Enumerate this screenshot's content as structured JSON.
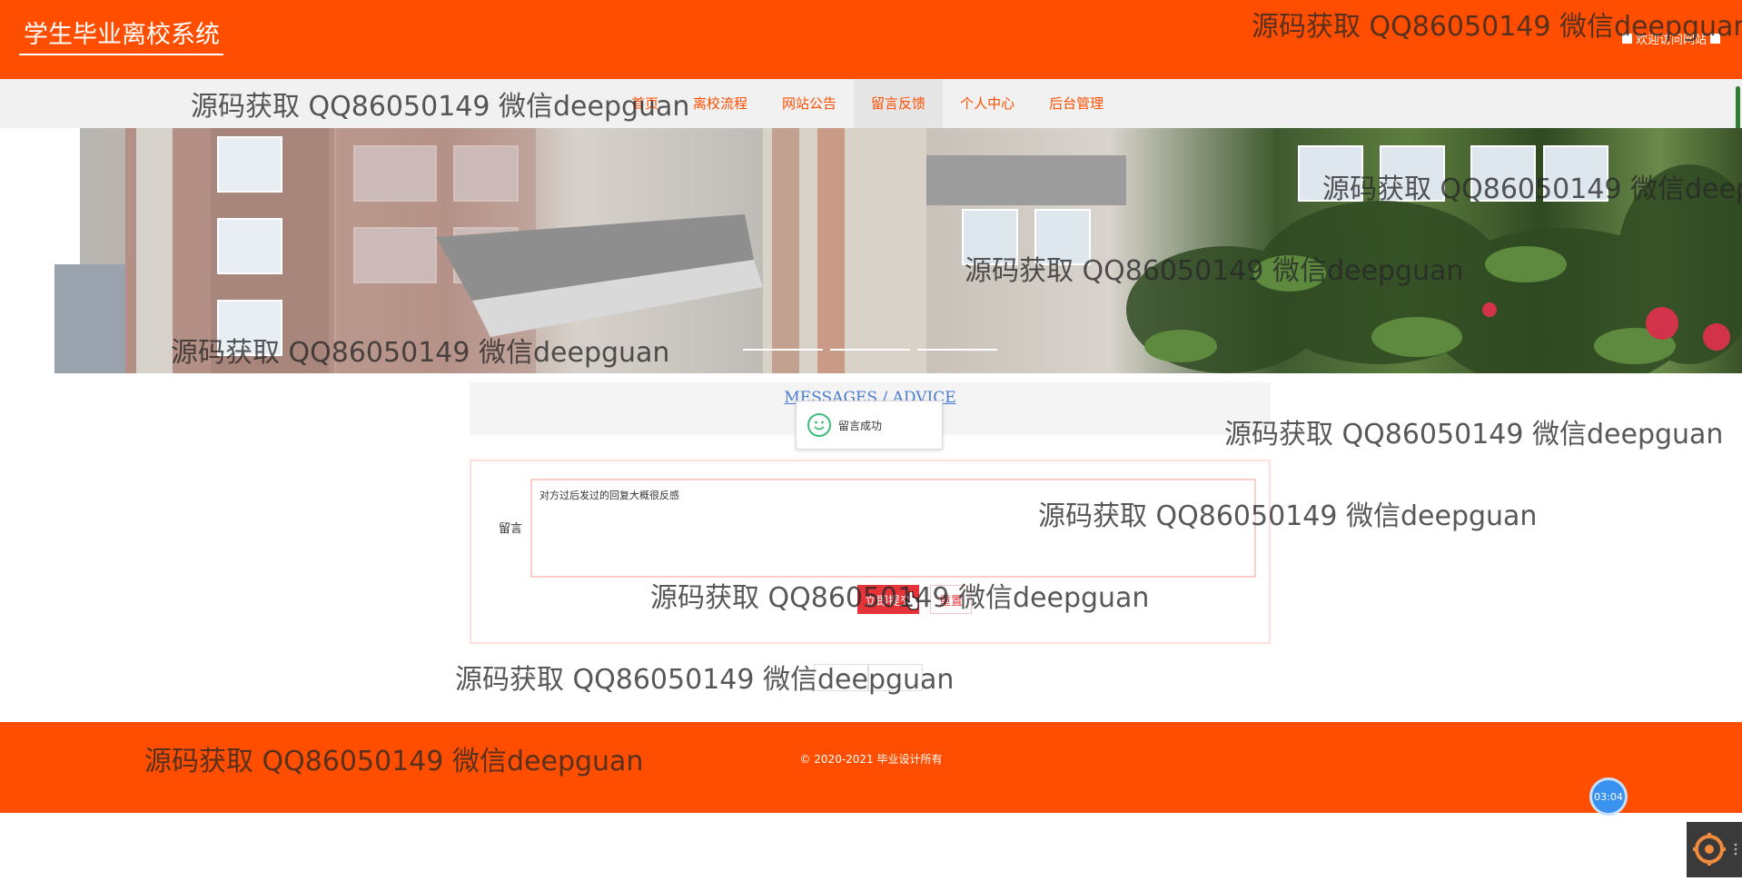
{
  "header": {
    "site_title": "学生毕业离校系统",
    "welcome_text": "欢迎访问网站"
  },
  "nav": {
    "items": [
      {
        "label": "首页"
      },
      {
        "label": "离校流程"
      },
      {
        "label": "网站公告"
      },
      {
        "label": "留言反馈"
      },
      {
        "label": "个人中心"
      },
      {
        "label": "后台管理"
      }
    ],
    "active": "留言反馈"
  },
  "message_section": {
    "title": "MESSAGES / ADVICE"
  },
  "toast": {
    "text": "留言成功"
  },
  "form": {
    "label": "留言",
    "content": "对方过后发过的回复大概很反感",
    "submit_label": "立即提交",
    "reset_label": "重置"
  },
  "footer": {
    "copyright": "© 2020-2021 毕业设计所有"
  },
  "timer": {
    "value": "03:04"
  },
  "watermark": {
    "text": "源码获取 QQ86050149 微信deepguan"
  },
  "colors": {
    "brand": "#ff4e00",
    "accent_red": "#e5333a",
    "success_green": "#3cbf7a"
  },
  "icons": [
    "smile-icon",
    "hand-pointer-icon",
    "settings-gear-icon"
  ]
}
